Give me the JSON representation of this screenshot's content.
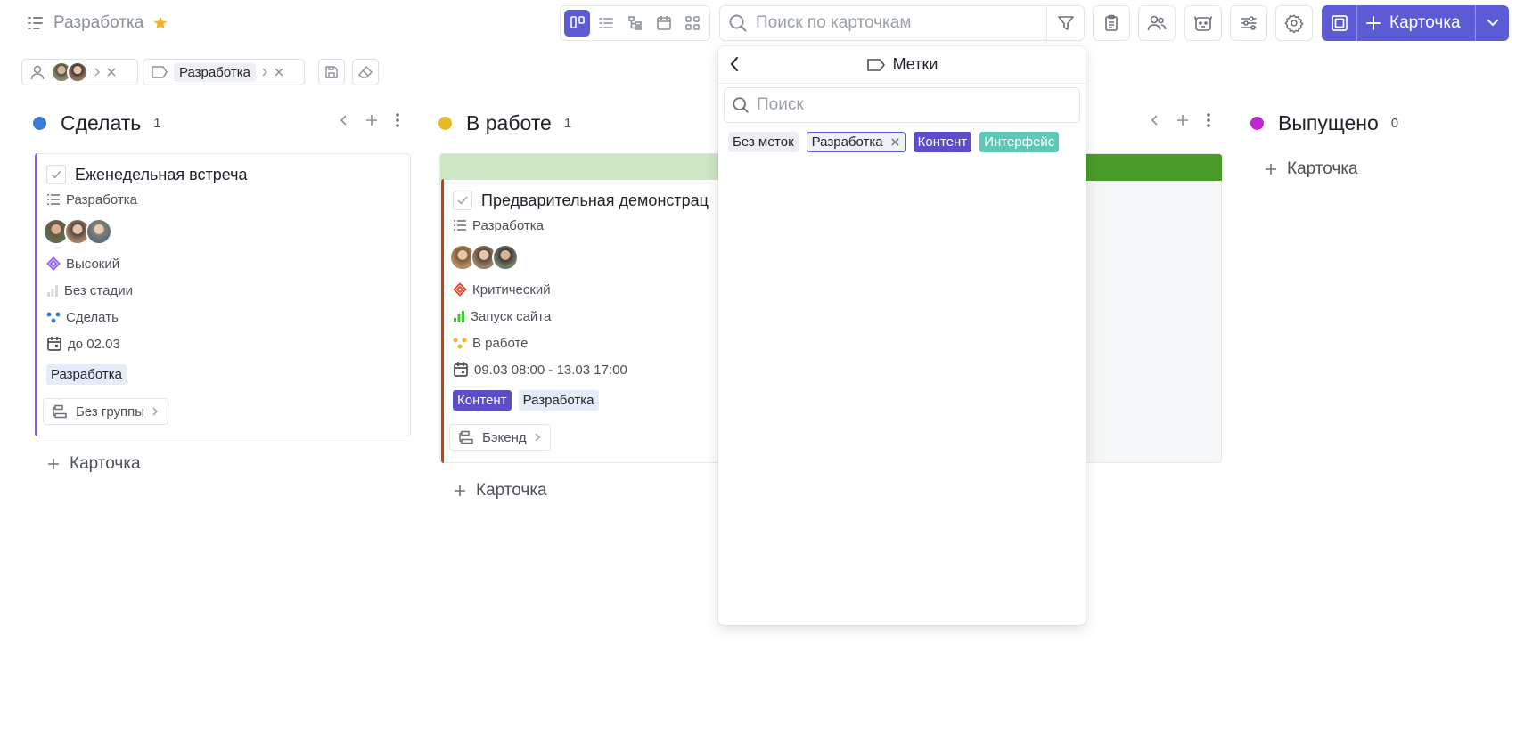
{
  "header": {
    "title": "Разработка",
    "search_placeholder": "Поиск по карточкам",
    "create_label": "Карточка"
  },
  "filters": {
    "label_chip": "Разработка"
  },
  "columns": [
    {
      "name": "Сделать",
      "count": "1",
      "color": "#3a7bd5",
      "add_label": "Карточка"
    },
    {
      "name": "В работе",
      "count": "1",
      "color": "#e8b923",
      "add_label": "Карточка"
    },
    {
      "name": "Выпущено",
      "count": "0",
      "color": "#c026d3",
      "add_label": "Карточка"
    }
  ],
  "cards": [
    {
      "title": "Еженедельная встреча",
      "project": "Разработка",
      "priority": "Высокий",
      "stage": "Без стадии",
      "status": "Сделать",
      "date": "до 02.03",
      "labels": [
        "Разработка"
      ],
      "group": "Без группы",
      "accent": "#8b5cf6"
    },
    {
      "title": "Предварительная демонстрац",
      "project": "Разработка",
      "priority": "Критический",
      "stage": "Запуск сайта",
      "status": "В работе",
      "date": "09.03 08:00 - 13.03 17:00",
      "labels": [
        "Контент",
        "Разработка"
      ],
      "group": "Бэкенд",
      "accent": "#c2410c"
    }
  ],
  "popover": {
    "title": "Метки",
    "search_placeholder": "Поиск",
    "tags": [
      "Без меток",
      "Разработка",
      "Контент",
      "Интерфейс"
    ]
  }
}
